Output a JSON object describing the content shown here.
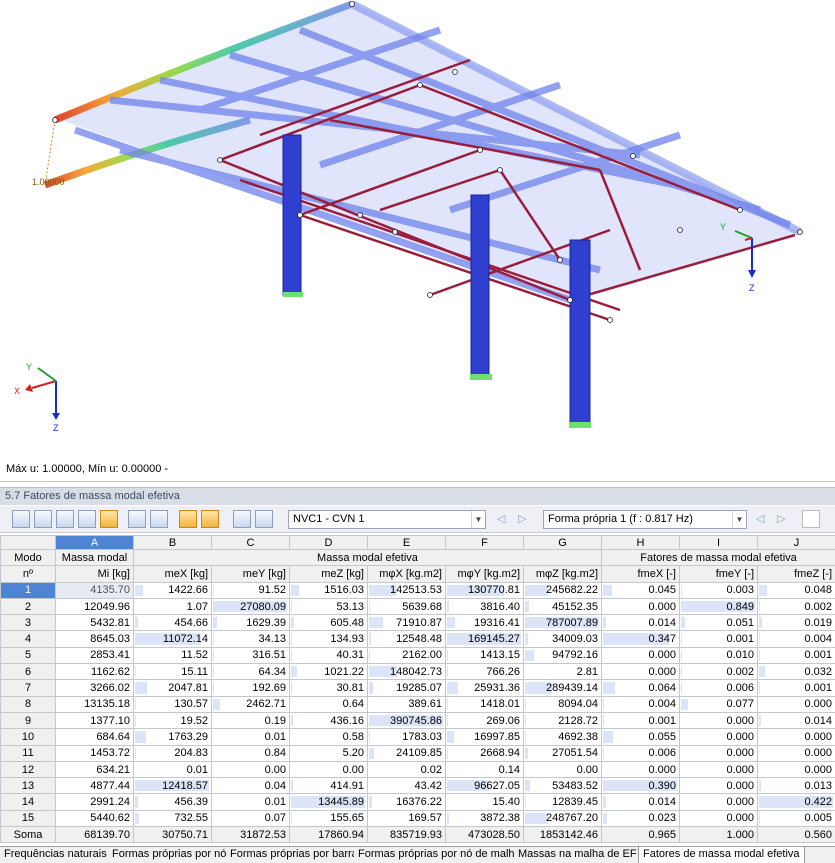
{
  "viewport": {
    "deformation_label": "1.00000",
    "status": "Máx u: 1.00000, Mín u: 0.00000 -",
    "axes_left": {
      "x": "X",
      "y": "Y",
      "z": "Z"
    },
    "axes_right": {
      "y": "Y",
      "z": "Z"
    }
  },
  "panel": {
    "title": "5.7 Fatores de massa modal efetiva"
  },
  "toolbar": {
    "case_combo": "NVC1 - CVN 1",
    "mode_combo": "Forma própria 1 (f : 0.817 Hz)"
  },
  "table": {
    "letters": [
      "A",
      "B",
      "C",
      "D",
      "E",
      "F",
      "G",
      "H",
      "I",
      "J"
    ],
    "hdr_modo": "Modo",
    "hdr_no": "nº",
    "hdr_mass": "Massa modal",
    "hdr_mass_sym": "Mi [kg]",
    "hdr_eff_group": "Massa modal efetiva",
    "hdr_fac_group": "Fatores de massa modal efetiva",
    "subheaders": [
      "meX [kg]",
      "meY [kg]",
      "meZ [kg]",
      "mφX [kg.m2]",
      "mφY [kg.m2]",
      "mφZ [kg.m2]",
      "fmeX [-]",
      "fmeY [-]",
      "fmeZ [-]"
    ],
    "rows": [
      [
        "1",
        "4135.70",
        "1422.66",
        "91.52",
        "1516.03",
        "142513.53",
        "130770.81",
        "245682.22",
        "0.045",
        "0.003",
        "0.048"
      ],
      [
        "2",
        "12049.96",
        "1.07",
        "27080.09",
        "53.13",
        "5639.68",
        "3816.40",
        "45152.35",
        "0.000",
        "0.849",
        "0.002"
      ],
      [
        "3",
        "5432.81",
        "454.66",
        "1629.39",
        "605.48",
        "71910.87",
        "19316.41",
        "787007.89",
        "0.014",
        "0.051",
        "0.019"
      ],
      [
        "4",
        "8645.03",
        "11072.14",
        "34.13",
        "134.93",
        "12548.48",
        "169145.27",
        "34009.03",
        "0.347",
        "0.001",
        "0.004"
      ],
      [
        "5",
        "2853.41",
        "11.52",
        "316.51",
        "40.31",
        "2162.00",
        "1413.15",
        "94792.16",
        "0.000",
        "0.010",
        "0.001"
      ],
      [
        "6",
        "1162.62",
        "15.11",
        "64.34",
        "1021.22",
        "148042.73",
        "766.26",
        "2.81",
        "0.000",
        "0.002",
        "0.032"
      ],
      [
        "7",
        "3266.02",
        "2047.81",
        "192.69",
        "30.81",
        "19285.07",
        "25931.36",
        "289439.14",
        "0.064",
        "0.006",
        "0.001"
      ],
      [
        "8",
        "13135.18",
        "130.57",
        "2462.71",
        "0.64",
        "389.61",
        "1418.01",
        "8094.04",
        "0.004",
        "0.077",
        "0.000"
      ],
      [
        "9",
        "1377.10",
        "19.52",
        "0.19",
        "436.16",
        "390745.86",
        "269.06",
        "2128.72",
        "0.001",
        "0.000",
        "0.014"
      ],
      [
        "10",
        "684.64",
        "1763.29",
        "0.01",
        "0.58",
        "1783.03",
        "16997.85",
        "4692.38",
        "0.055",
        "0.000",
        "0.000"
      ],
      [
        "11",
        "1453.72",
        "204.83",
        "0.84",
        "5.20",
        "24109.85",
        "2668.94",
        "27051.54",
        "0.006",
        "0.000",
        "0.000"
      ],
      [
        "12",
        "634.21",
        "0.01",
        "0.00",
        "0.00",
        "0.02",
        "0.14",
        "0.00",
        "0.000",
        "0.000",
        "0.000"
      ],
      [
        "13",
        "4877.44",
        "12418.57",
        "0.04",
        "414.91",
        "43.42",
        "96627.05",
        "53483.52",
        "0.390",
        "0.000",
        "0.013"
      ],
      [
        "14",
        "2991.24",
        "456.39",
        "0.01",
        "13445.89",
        "16376.22",
        "15.40",
        "12839.45",
        "0.014",
        "0.000",
        "0.422"
      ],
      [
        "15",
        "5440.62",
        "732.55",
        "0.07",
        "155.65",
        "169.57",
        "3872.38",
        "248767.20",
        "0.023",
        "0.000",
        "0.005"
      ]
    ],
    "sum_row": [
      "Soma",
      "68139.70",
      "30750.71",
      "31872.53",
      "17860.94",
      "835719.93",
      "473028.50",
      "1853142.46",
      "0.965",
      "1.000",
      "0.560"
    ]
  },
  "tabs": [
    "Frequências naturais",
    "Formas próprias por nó",
    "Formas próprias por barra",
    "Formas próprias por nó de malha",
    "Massas na malha de EF",
    "Fatores de massa modal efetiva"
  ],
  "colors": {
    "member_blue": "#3a4fd8",
    "member_red": "#9b1d3c",
    "selection": "#4f84d4"
  }
}
